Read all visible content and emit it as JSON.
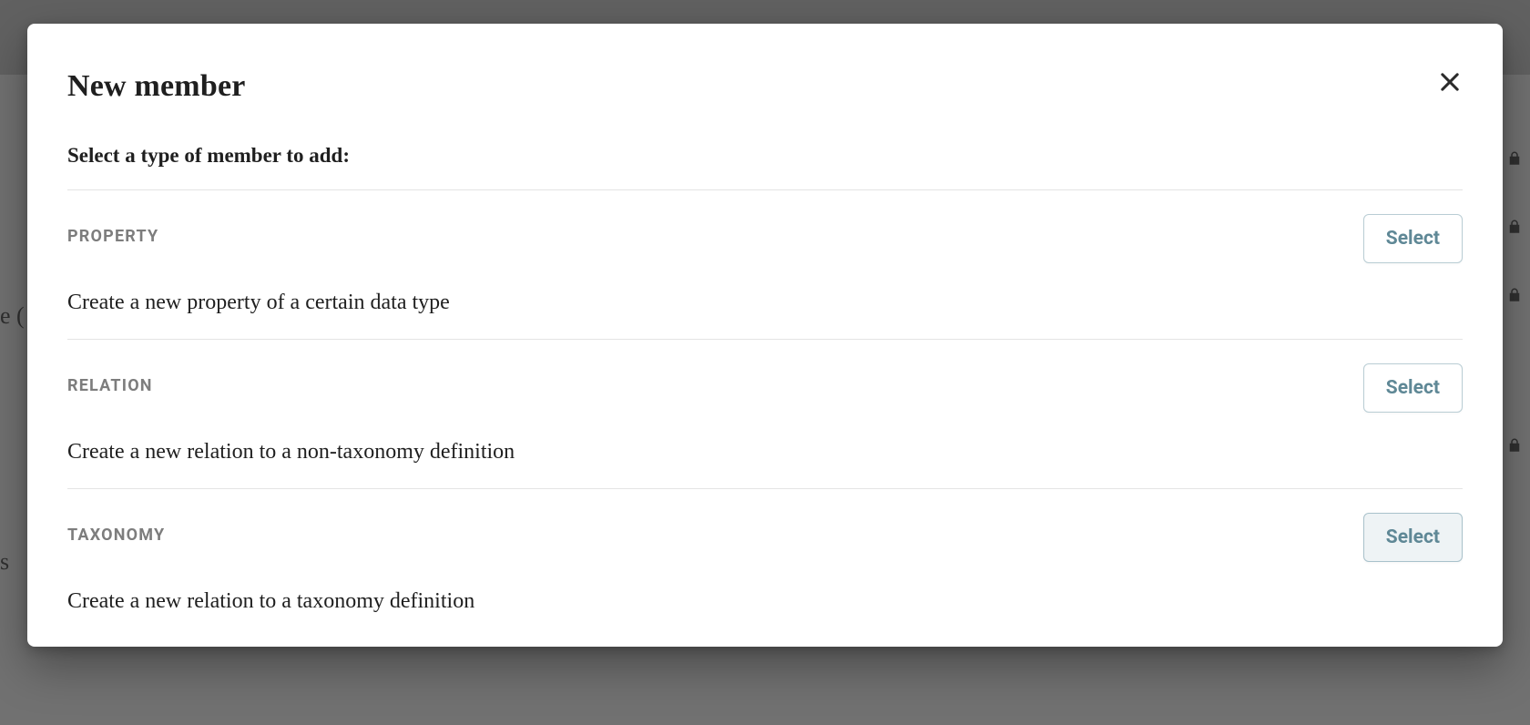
{
  "dialog": {
    "title": "New member",
    "subtitle": "Select a type of member to add:",
    "close_icon_name": "close-icon",
    "options": [
      {
        "label": "PROPERTY",
        "description": "Create a new property of a certain data type",
        "button": "Select",
        "active": false
      },
      {
        "label": "RELATION",
        "description": "Create a new relation to a non-taxonomy definition",
        "button": "Select",
        "active": false
      },
      {
        "label": "TAXONOMY",
        "description": "Create a new relation to a taxonomy definition",
        "button": "Select",
        "active": true
      }
    ]
  },
  "background": {
    "text_fragments": [
      "e (",
      "s"
    ]
  }
}
